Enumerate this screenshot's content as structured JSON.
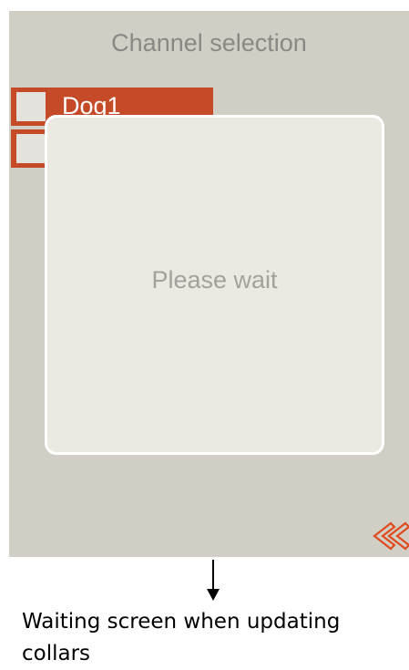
{
  "screen": {
    "title": "Channel selection",
    "channels": [
      {
        "label": "Dog1",
        "checked": false
      },
      {
        "label": "",
        "checked": false
      }
    ],
    "back_icon": "double-chevron-left-icon",
    "colors": {
      "background": "#d1cec6",
      "channel_item": "#c44a28",
      "back_icon": "#e04a1c",
      "modal": "#ebe9e2"
    }
  },
  "modal": {
    "message": "Please wait"
  },
  "annotation": {
    "arrow_icon": "down-arrow-icon",
    "caption": "Waiting screen when updating collars"
  }
}
